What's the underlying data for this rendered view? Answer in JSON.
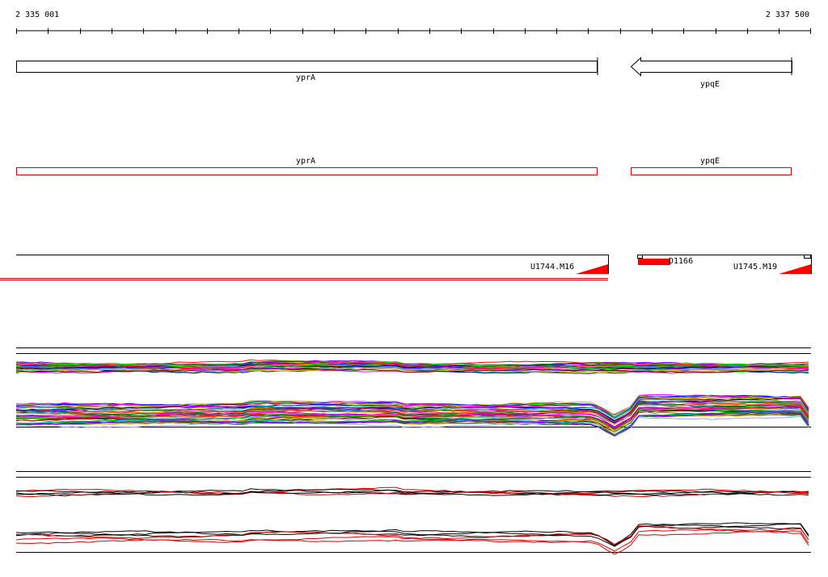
{
  "ruler": {
    "start_label": "2 335 001",
    "end_label": "2 337 500"
  },
  "genes": [
    {
      "name": "yprA",
      "strand": "+",
      "track": "annotation"
    },
    {
      "name": "ypqE",
      "strand": "-",
      "track": "annotation"
    },
    {
      "name": "yprA",
      "strand": "+",
      "track": "transcript"
    },
    {
      "name": "ypqE",
      "strand": "+",
      "track": "transcript"
    }
  ],
  "segments": [
    {
      "name": "U1744.M16"
    },
    {
      "name": "D1166"
    },
    {
      "name": "U1745.M19"
    }
  ],
  "colors": {
    "gene_outline": "#000000",
    "transcript_outline": "#e00000",
    "segment_fill": "#ff0000",
    "axis": "#000000"
  }
}
